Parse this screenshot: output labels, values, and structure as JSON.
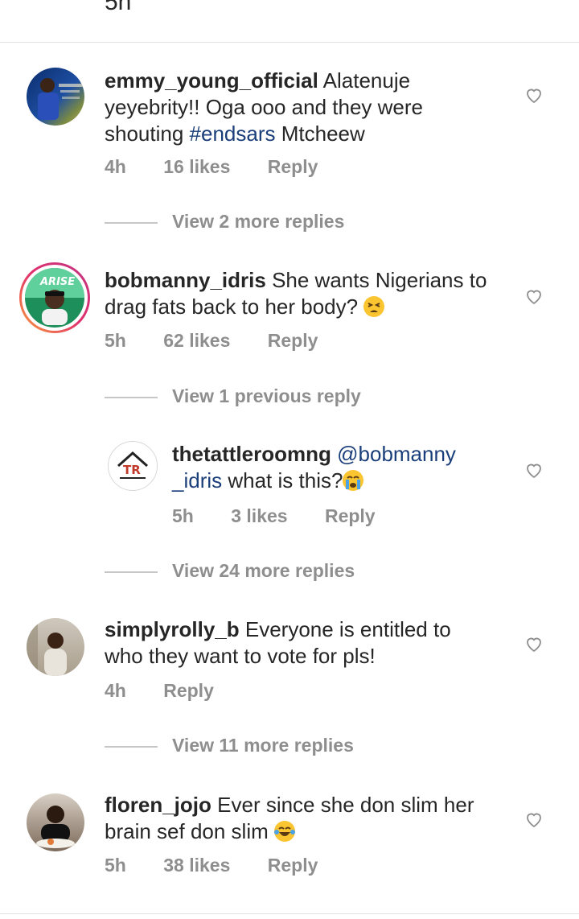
{
  "top_partial_meta": "5h",
  "comments": [
    {
      "username": "emmy_young_official",
      "text_before": "Alatenuje yeyebrity!! Oga ooo and they were shouting ",
      "hashtag": "#endsars",
      "text_after": " Mtcheew",
      "time": "4h",
      "likes": "16 likes",
      "reply": "Reply",
      "view_replies": "View 2 more replies"
    },
    {
      "username": "bobmanny_idris",
      "text": "She wants Nigerians to drag fats back to her body? ",
      "emoji": "tired-face",
      "time": "5h",
      "likes": "62 likes",
      "reply": "Reply",
      "view_previous": "View 1 previous reply"
    },
    {
      "username": "thetattleroomng",
      "mention": "@bobmanny _idris",
      "text": " what is this?",
      "emoji": "crying-face",
      "time": "5h",
      "likes": "3 likes",
      "reply": "Reply",
      "view_replies": "View 24 more replies"
    },
    {
      "username": "simplyrolly_b",
      "text": "Everyone is entitled to who they want to vote for pls!",
      "time": "4h",
      "reply": "Reply",
      "view_replies": "View 11 more replies"
    },
    {
      "username": "floren_jojo",
      "text": "Ever since she don slim her brain sef don slim ",
      "emoji": "laughing-tears-face",
      "time": "5h",
      "likes": "38 likes",
      "reply": "Reply"
    }
  ],
  "logo_text": "TR",
  "colors": {
    "link": "#1a3e7a",
    "meta": "#8e8e8e",
    "text": "#262626"
  }
}
